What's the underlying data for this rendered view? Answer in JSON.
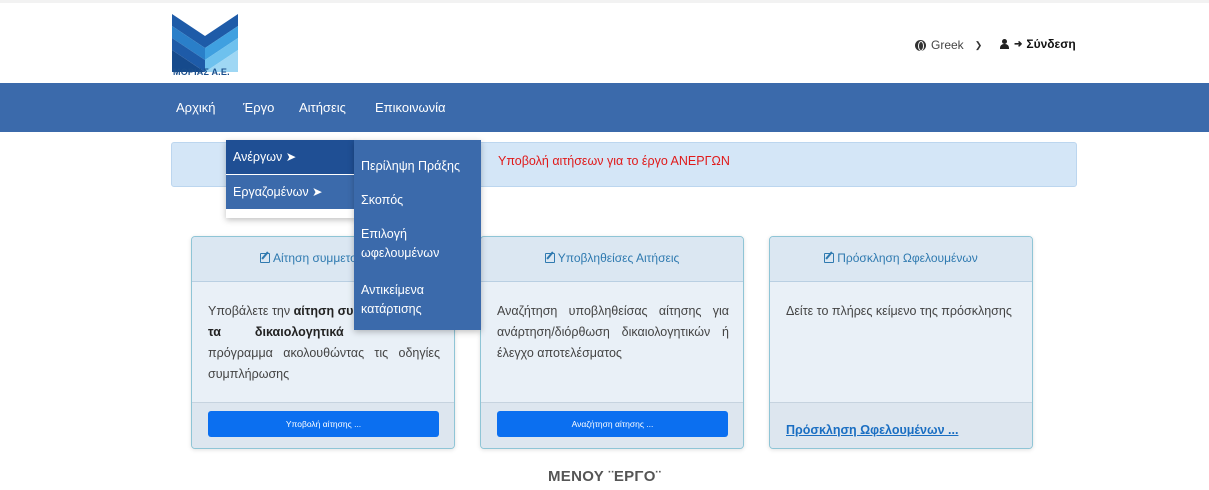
{
  "header": {
    "logo_text": "ΜΟΡΙΑΣ Α.Ε.",
    "language": "Greek",
    "login_label": "Σύνδεση"
  },
  "nav": {
    "items": [
      "Αρχική",
      "Έργο",
      "Αιτήσεις",
      "Επικοινωνία"
    ]
  },
  "banner": {
    "text": "Υποβολή αιτήσεων για το έργο  ΑΝΕΡΓΩΝ"
  },
  "dropdown": {
    "items": [
      "Ανέργων ➤",
      "Εργαζομένων ➤"
    ],
    "submenu": [
      "Περίληψη Πράξης",
      "Σκοπός",
      "Επιλογή ωφελουμένων",
      "Αντικείμενα κατάρτισης"
    ]
  },
  "cards": [
    {
      "title": "Αίτηση συμμετοχής σ",
      "body_pre": "Υποβάλετε την ",
      "body_bold1": "αίτηση συ",
      "body_line2a": "τα",
      "body_bold2": "δικαιολογητικά",
      "body_rest": "πρόγραμμα ακολουθώντας τις οδηγίες συμπλήρωσης",
      "button": "Υποβολή αίτησης ..."
    },
    {
      "title": "Υποβληθείσες Αιτήσεις",
      "body": "Αναζήτηση υποβληθείσας αίτησης για ανάρτηση/διόρθωση δικαιολογητικών ή έλεγχο αποτελέσματος",
      "button": "Αναζήτηση αίτησης ..."
    },
    {
      "title": "Πρόσκληση Ωφελουμένων",
      "body": "Δείτε το πλήρες κείμενο της πρόσκλησης",
      "link": "Πρόσκληση Ωφελουμένων ..."
    }
  ],
  "caption": "ΜΕΝΟΥ ¨ΕΡΓΟ¨",
  "colors": {
    "nav": "#3b6aab",
    "banner": "#d4e6f7",
    "alert_text": "#e01a1a",
    "button": "#0b6ff0",
    "link": "#1a6ec2"
  },
  "icons": [
    "globe-icon",
    "chevron-down-icon",
    "sign-in-icon",
    "edit-icon"
  ]
}
